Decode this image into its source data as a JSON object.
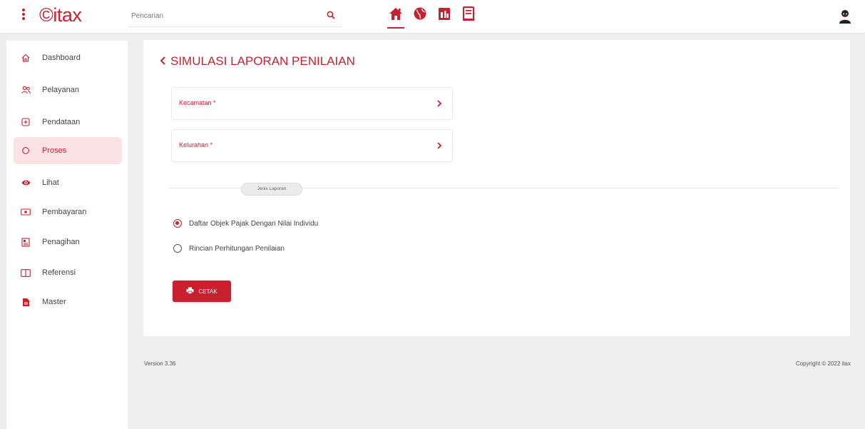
{
  "header": {
    "logo_text": "©itax",
    "search_placeholder": "Pencarian",
    "nav_icons": [
      "home-icon",
      "globe-icon",
      "document-icon",
      "report-icon"
    ],
    "accent_color": "#c8202f"
  },
  "sidebar": {
    "items": [
      {
        "label": "Dashboard",
        "icon": "home-outline-icon"
      },
      {
        "label": "Pelayanan",
        "icon": "users-icon"
      },
      {
        "label": "Pendataan",
        "icon": "plus-box-icon"
      },
      {
        "label": "Proses",
        "icon": "circle-icon",
        "active": true
      },
      {
        "label": "Lihat",
        "icon": "eye-icon"
      },
      {
        "label": "Pembayaran",
        "icon": "money-icon"
      },
      {
        "label": "Penagihan",
        "icon": "invoice-icon"
      },
      {
        "label": "Referensi",
        "icon": "book-icon"
      },
      {
        "label": "Master",
        "icon": "file-icon"
      }
    ]
  },
  "main": {
    "title": "SIMULASI LAPORAN PENILAIAN",
    "fields": {
      "kecamatan": "Kecamatan *",
      "kelurahan": "Kelurahan *"
    },
    "section_label": "Jenis Laporan",
    "options": [
      {
        "label": "Daftar Objek Pajak Dengan Nilai Individu",
        "selected": true
      },
      {
        "label": "Rincian Perhitungan Penilaian",
        "selected": false
      }
    ],
    "print_button": "CETAK"
  },
  "footer": {
    "version": "Version 3.36",
    "copyright": "Copyright © 2022 itax"
  }
}
